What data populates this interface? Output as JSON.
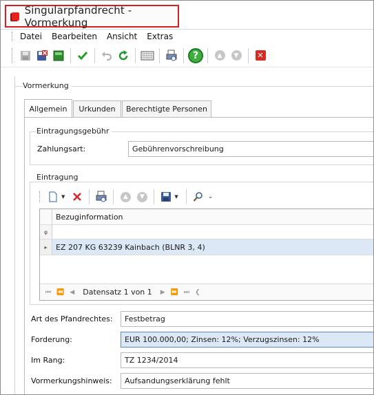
{
  "window": {
    "title": "Singularpfandrecht - Vormerkung"
  },
  "menu": [
    "Datei",
    "Bearbeiten",
    "Ansicht",
    "Extras"
  ],
  "toolbar_icons": [
    "save-disabled-icon",
    "save-close-icon",
    "green-square-icon",
    "checkmark-icon",
    "undo-icon",
    "refresh-icon",
    "keyboard-icon",
    "print-icon",
    "help-icon",
    "up-disabled-icon",
    "down-disabled-icon",
    "close-red-icon"
  ],
  "colors": {
    "accent_red": "#d21f1f",
    "help_green": "#3fae3f",
    "highlight": "#dce8f5"
  },
  "vormerkung": {
    "group_title": "Vormerkung",
    "tabs": [
      "Allgemein",
      "Urkunden",
      "Berechtigte Personen"
    ],
    "active_tab": "Allgemein",
    "eintragungsgebuehr": {
      "title": "Eintragungsgebühr",
      "zahlungsart_label": "Zahlungsart:",
      "zahlungsart_value": "Gebührenvorschreibung"
    },
    "eintragung": {
      "title": "Eintragung",
      "grid": {
        "column": "Bezuginformation",
        "filter_symbol": "φ",
        "rows": [
          {
            "indicator": "▸",
            "value": "EZ 207 KG 63239 Kainbach (BLNR 3, 4)"
          }
        ],
        "navigator_text": "Datensatz 1 von 1"
      }
    },
    "fields": {
      "art_label": "Art des Pfandrechtes:",
      "art_value": "Festbetrag",
      "forderung_label": "Forderung:",
      "forderung_value": "EUR 100.000,00; Zinsen: 12%; Verzugszinsen: 12%",
      "rang_label": "Im Rang:",
      "rang_value": "TZ 1234/2014",
      "hinweis_label": "Vormerkungshinweis:",
      "hinweis_value": "Aufsandungserklärung fehlt"
    }
  }
}
